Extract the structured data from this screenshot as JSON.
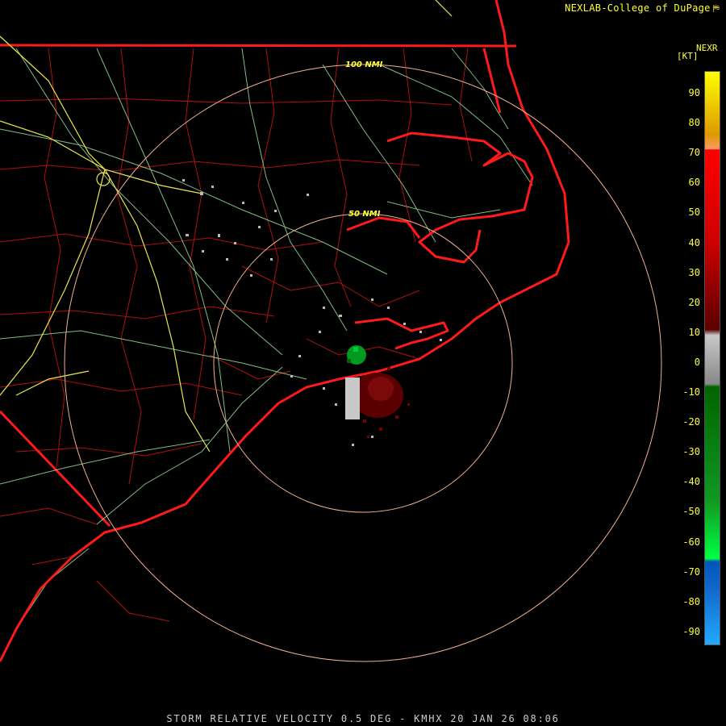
{
  "attribution": {
    "text": "NEXLAB-College of DuPage",
    "icon": "bookmark-flag-icon"
  },
  "legend": {
    "title": "NEXR",
    "unit": "[KT]",
    "ticks": [
      "90",
      "80",
      "70",
      "60",
      "50",
      "40",
      "30",
      "20",
      "10",
      "0",
      "-10",
      "-20",
      "-30",
      "-40",
      "-50",
      "-60",
      "-70",
      "-80",
      "-90"
    ],
    "colors": {
      "top": "#ffff00",
      "orange": "#ff9966",
      "red": "#ff0000",
      "dark_red": "#5a0000",
      "near_zero_gray": "#c8c8c8",
      "dark_green": "#006400",
      "bright_green": "#00ff44",
      "blue": "#0055bb",
      "light_blue": "#22aaff"
    }
  },
  "range_rings": [
    {
      "label": "100 NMI"
    },
    {
      "label": "50 NMI"
    }
  ],
  "caption": "STORM RELATIVE VELOCITY 0.5 DEG - KMHX 20 JAN 26 08:06",
  "map_colors": {
    "coastline": "#ff1a1a",
    "county_lines": "#b01010",
    "highways": "#99dd99",
    "interstates": "#e8e84a",
    "range_rings": "#f0b090"
  }
}
